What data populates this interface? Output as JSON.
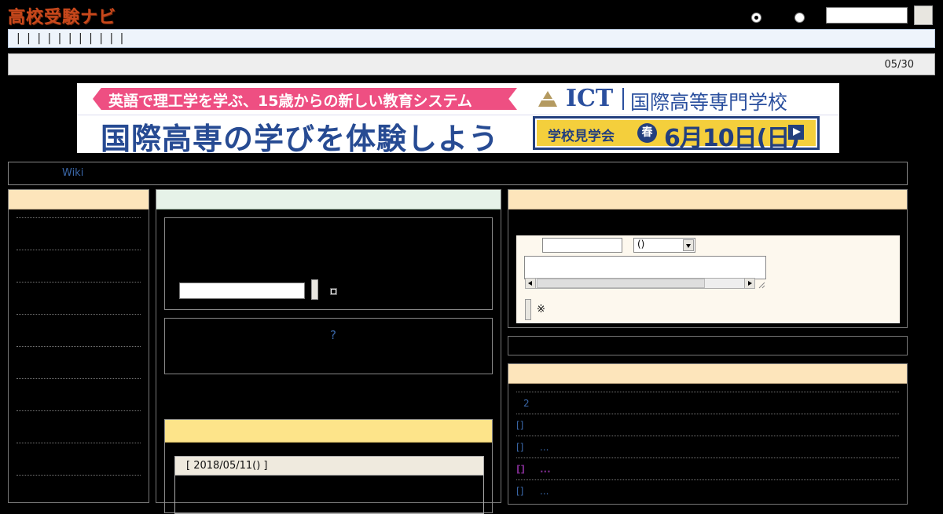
{
  "header": {
    "logo_text": "高校受験ナビ",
    "search_value": "",
    "search_button_label": ""
  },
  "nav_bar": {
    "text": "| | | | | | | | | | |"
  },
  "info_bar": {
    "date": "05/30"
  },
  "banner": {
    "tagline": "英語で理工学を学ぶ、15歳からの新しい教育システム",
    "logo": "ICT",
    "school_name": "国際高等専門学校",
    "headline": "国際高専の学びを体験しよう",
    "cta_label": "学校見学会",
    "cta_badge": "春",
    "cta_date": "6月10日(日)"
  },
  "wiki_bar": {
    "link": "Wiki"
  },
  "center": {
    "help_link": "?",
    "news_item_date": "[ 2018/05/11() ]"
  },
  "right": {
    "select_value": "()",
    "note_mark": "※",
    "list": [
      {
        "prefix": "",
        "text": "2"
      },
      {
        "prefix": "[]",
        "text": ""
      },
      {
        "prefix": "[]",
        "text": "..."
      },
      {
        "prefix": "[]",
        "text": "...",
        "visited": true
      },
      {
        "prefix": "[]",
        "text": "..."
      }
    ]
  },
  "colors": {
    "logo": "#c8481c",
    "link": "#3a67a8",
    "visited_link": "#7a2a8a",
    "panel_head_orange": "#fde5bb",
    "panel_head_green": "#e6f2e8",
    "panel_head_yellow": "#fde48a",
    "banner_blue": "#274b93",
    "banner_pink": "#ee4f82",
    "cta_yellow": "#f4cf3c"
  }
}
